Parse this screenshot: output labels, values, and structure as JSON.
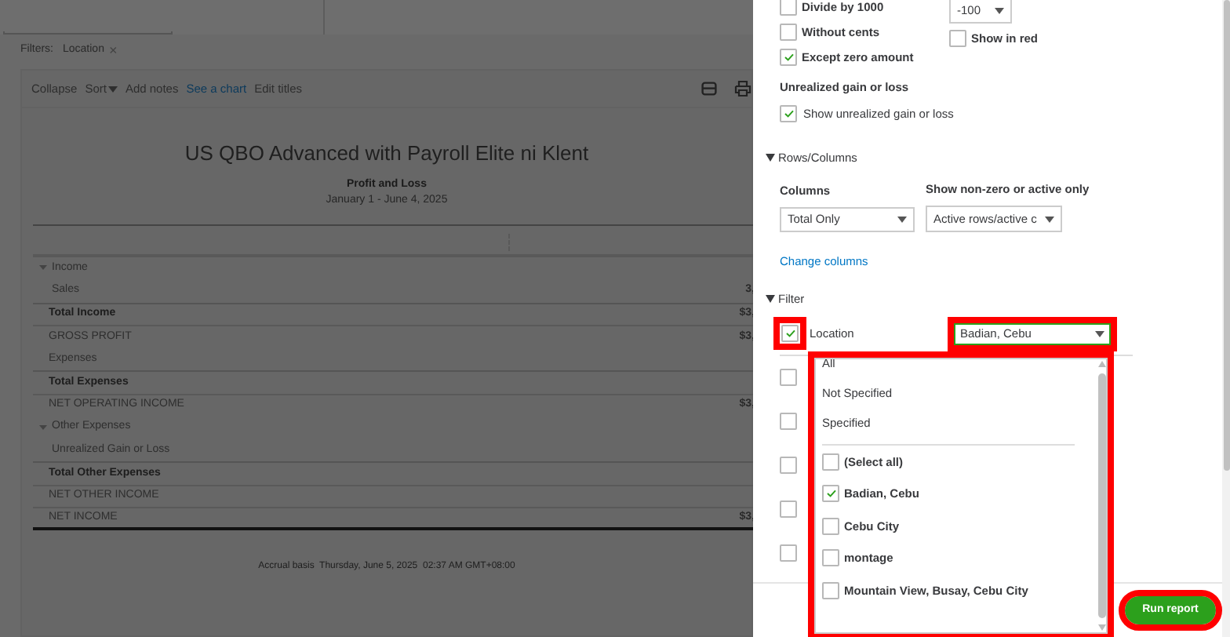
{
  "filters": {
    "label": "Filters:",
    "chips": [
      {
        "label": "Location",
        "remove": "×"
      }
    ]
  },
  "toolbar": {
    "actions": [
      {
        "label": "Collapse",
        "kind": "plain"
      },
      {
        "label": "Sort",
        "kind": "menu"
      },
      {
        "label": "Add notes",
        "kind": "plain"
      },
      {
        "label": "See a chart",
        "kind": "link"
      },
      {
        "label": "Edit titles",
        "kind": "plain"
      }
    ]
  },
  "report": {
    "company": "US QBO Advanced with Payroll Elite ni Klent",
    "title": "Profit and Loss",
    "period": "January 1 - June 4, 2025",
    "rows": [
      {
        "label": "Income",
        "kind": "section"
      },
      {
        "label": "Sales",
        "kind": "item",
        "amount": "3,"
      },
      {
        "label": "Total Income",
        "kind": "total",
        "amount": "$3,"
      },
      {
        "label": "GROSS PROFIT",
        "kind": "summary",
        "amount": "$3,"
      },
      {
        "label": "Expenses",
        "kind": "subitem"
      },
      {
        "label": "Total Expenses",
        "kind": "total"
      },
      {
        "label": "NET OPERATING INCOME",
        "kind": "summary",
        "amount": "$3,"
      },
      {
        "label": "Other Expenses",
        "kind": "section"
      },
      {
        "label": "Unrealized Gain or Loss",
        "kind": "item"
      },
      {
        "label": "Total Other Expenses",
        "kind": "total"
      },
      {
        "label": "NET OTHER INCOME",
        "kind": "summary"
      },
      {
        "label": "NET INCOME",
        "kind": "final",
        "amount": "$3,"
      }
    ],
    "footer": "Accrual basis  Thursday, June 5, 2025  02:37 AM GMT+08:00"
  },
  "number_format": {
    "checkboxes": [
      {
        "label": "Divide by 1000",
        "checked": false
      },
      {
        "label": "Without cents",
        "checked": false
      },
      {
        "label": "Except zero amount",
        "checked": true
      }
    ],
    "negative_value": "-100",
    "show_in_red": {
      "label": "Show in red",
      "checked": false
    }
  },
  "unrealized": {
    "heading": "Unrealized gain or loss",
    "checkbox": {
      "label": "Show unrealized gain or loss",
      "checked": true
    }
  },
  "rows_columns": {
    "heading": "Rows/Columns",
    "expanded": true,
    "columns_label": "Columns",
    "columns_value": "Total Only",
    "nonzero_label": "Show non-zero or active only",
    "nonzero_value": "Active rows/active c",
    "link": "Change columns"
  },
  "filter": {
    "heading": "Filter",
    "expanded": true,
    "location": {
      "label": "Location",
      "checked": true,
      "highlighted": true,
      "value": "Badian, Cebu",
      "value_highlighted": true
    },
    "other_filters": [
      {
        "checked": false
      },
      {
        "checked": false
      },
      {
        "checked": false
      },
      {
        "checked": false
      },
      {
        "checked": false
      }
    ]
  },
  "dropdown": {
    "highlighted": true,
    "presets": [
      "All",
      "Not Specified",
      "Specified"
    ],
    "options": [
      {
        "label": "(Select all)",
        "checked": false
      },
      {
        "label": "Badian, Cebu",
        "checked": true
      },
      {
        "label": "Cebu City",
        "checked": false
      },
      {
        "label": "montage",
        "checked": false
      },
      {
        "label": "Mountain View, Busay, Cebu City",
        "checked": false
      }
    ]
  },
  "run_button": {
    "label": "Run report",
    "highlighted": true
  }
}
